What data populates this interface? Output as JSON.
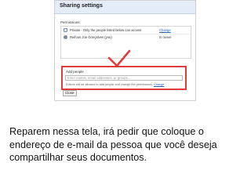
{
  "dialog": {
    "title": "Sharing settings",
    "permissions_label": "Permissions:",
    "permissions": [
      {
        "icon": "lock-icon",
        "text": "Private - Only the people listed below can access",
        "action": "Change"
      },
      {
        "icon": "user-icon",
        "text": "Reifous Joe Gonçalves (you)",
        "role": "Is owner"
      }
    ],
    "add_people": {
      "label": "Add people",
      "placeholder": "Enter names, email addresses, or groups...",
      "note": "Editors will be allowed to add people and change the permissions.",
      "note_link": "Change"
    },
    "close_label": "Close"
  },
  "annotation": {
    "color": "#e23b3b"
  },
  "caption": "Reparem nessa tela, irá pedir que coloque o endereço de e-mail da pessoa que você deseja compartilhar seus documentos."
}
